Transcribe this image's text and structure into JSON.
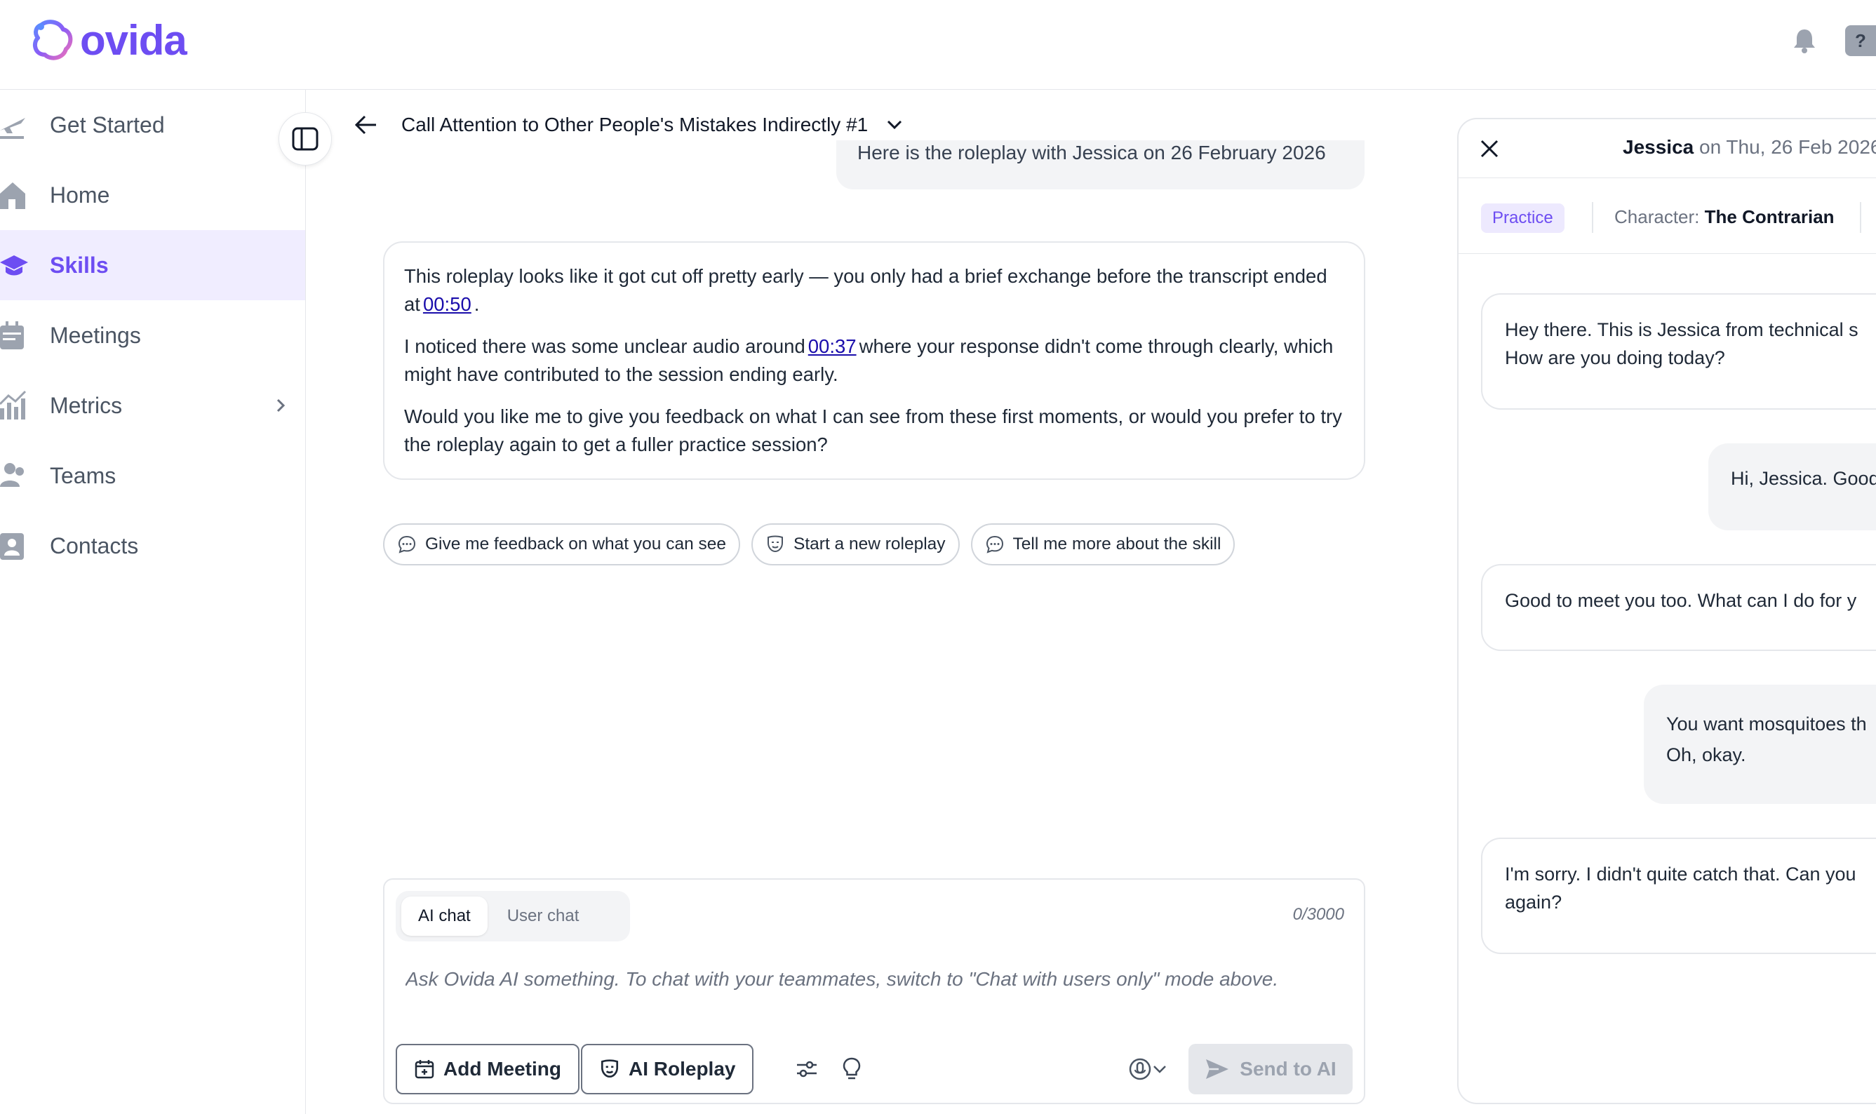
{
  "brand": {
    "name": "ovida",
    "color": "#6d4df2"
  },
  "nav": {
    "items": [
      {
        "label": "Get Started",
        "icon": "plane-icon"
      },
      {
        "label": "Home",
        "icon": "home-icon"
      },
      {
        "label": "Skills",
        "icon": "graduation-cap-icon",
        "active": true
      },
      {
        "label": "Meetings",
        "icon": "calendar-icon"
      },
      {
        "label": "Metrics",
        "icon": "chart-icon",
        "has_submenu": true
      },
      {
        "label": "Teams",
        "icon": "users-icon"
      },
      {
        "label": "Contacts",
        "icon": "contact-card-icon"
      }
    ]
  },
  "conversation": {
    "title": "Call Attention to Other People's Mistakes Indirectly #1",
    "previous_message": "Here is the roleplay with Jessica on 26 February 2026",
    "ai_message": {
      "p1_before": "This roleplay looks like it got cut off pretty early — you only had a brief exchange before the transcript ended at",
      "p1_link": "00:50",
      "p1_after": ".",
      "p2_before": "I noticed there was some unclear audio around",
      "p2_link": "00:37",
      "p2_after": "where your response didn't come through clearly, which might have contributed to the session ending early.",
      "p3": "Would you like me to give you feedback on what I can see from these first moments, or would you prefer to try the roleplay again to get a fuller practice session?"
    },
    "suggestions": [
      {
        "label": "Give me feedback on what you can see",
        "icon": "chat-bubble-icon"
      },
      {
        "label": "Start a new roleplay",
        "icon": "theater-mask-icon"
      },
      {
        "label": "Tell me more about the skill",
        "icon": "chat-bubble-icon"
      }
    ]
  },
  "composer": {
    "mode_ai": "AI chat",
    "mode_user": "User chat",
    "counter": "0/3000",
    "placeholder": "Ask Ovida AI something. To chat with your teammates, switch to \"Chat with users only\" mode above.",
    "add_meeting": "Add Meeting",
    "ai_roleplay": "AI Roleplay",
    "send": "Send to AI"
  },
  "transcript": {
    "name": "Jessica",
    "date_text": "on Thu, 26 Feb 2026",
    "badge": "Practice",
    "character_label": "Character:",
    "character_name": "The Contrarian",
    "messages": [
      {
        "speaker": "character",
        "line1": "Hey there. This is Jessica from technical s",
        "line2": "How are you doing today?"
      },
      {
        "speaker": "user",
        "line1": "Hi, Jessica. Good"
      },
      {
        "speaker": "character",
        "line1": "Good to meet you too. What can I do for y"
      },
      {
        "speaker": "user",
        "line1": "You want mosquitoes th",
        "line2": "Oh, okay."
      },
      {
        "speaker": "character",
        "line1": "I'm sorry. I didn't quite catch that. Can you",
        "line2": "again?"
      }
    ]
  },
  "colors": {
    "accent": "#6d4df2",
    "active_bg": "#f0edff",
    "link": "#1a0dab",
    "border": "#e5e7eb"
  }
}
